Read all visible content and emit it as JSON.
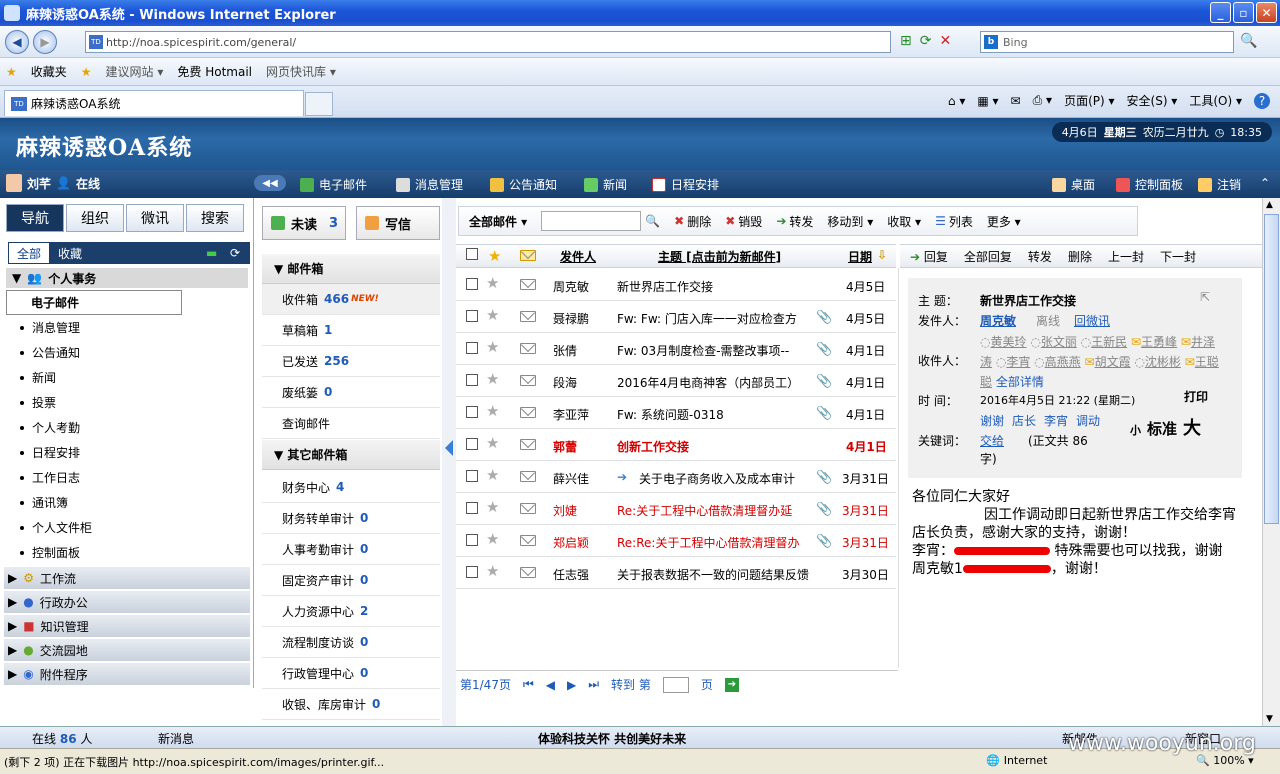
{
  "window": {
    "title": "麻辣诱惑OA系统 - Windows Internet Explorer"
  },
  "browser": {
    "url": "http://noa.spicespirit.com/general/",
    "search_placeholder": "Bing",
    "favorites_label": "收藏夹",
    "fav_items": [
      "建议网站 ▾",
      "免费 Hotmail",
      "网页快讯库 ▾"
    ],
    "tab_title": "麻辣诱惑OA系统",
    "commands": [
      "页面(P) ▾",
      "安全(S) ▾",
      "工具(O) ▾",
      "?"
    ]
  },
  "header": {
    "logo": "麻辣诱惑OA系统",
    "date": "4月6日",
    "weekday": "星期三",
    "lunar": "农历二月廿九",
    "time": "18:35"
  },
  "user": {
    "name": "刘芊",
    "status": "在线"
  },
  "menu": [
    "电子邮件",
    "消息管理",
    "公告通知",
    "新闻",
    "日程安排"
  ],
  "menu_right": [
    "桌面",
    "控制面板",
    "注销"
  ],
  "left": {
    "tabs": [
      "导航",
      "组织",
      "微讯",
      "搜索"
    ],
    "subtabs": [
      "全部",
      "收藏"
    ],
    "section": "个人事务",
    "items": [
      "电子邮件",
      "消息管理",
      "公告通知",
      "新闻",
      "投票",
      "个人考勤",
      "日程安排",
      "工作日志",
      "通讯簿",
      "个人文件柜",
      "控制面板"
    ],
    "accordion": [
      "工作流",
      "行政办公",
      "知识管理",
      "交流园地",
      "附件程序"
    ]
  },
  "folders": {
    "unread_label": "未读",
    "unread_count": "3",
    "compose_label": "写信",
    "mailbox_title": "邮件箱",
    "mailbox": [
      {
        "name": "收件箱",
        "count": "466",
        "new": "NEW!"
      },
      {
        "name": "草稿箱",
        "count": "1"
      },
      {
        "name": "已发送",
        "count": "256"
      },
      {
        "name": "废纸篓",
        "count": "0"
      },
      {
        "name": "查询邮件",
        "count": ""
      }
    ],
    "other_title": "其它邮件箱",
    "other": [
      {
        "name": "财务中心",
        "count": "4"
      },
      {
        "name": "财务转单审计",
        "count": "0"
      },
      {
        "name": "人事考勤审计",
        "count": "0"
      },
      {
        "name": "固定资产审计",
        "count": "0"
      },
      {
        "name": "人力资源中心",
        "count": "2"
      },
      {
        "name": "流程制度访谈",
        "count": "0"
      },
      {
        "name": "行政管理中心",
        "count": "0"
      },
      {
        "name": "收银、库房审计",
        "count": "0"
      }
    ]
  },
  "toolbar": {
    "all_mail": "全部邮件 ▾",
    "delete": "删除",
    "destroy": "销毁",
    "forward": "转发",
    "move": "移动到 ▾",
    "receive": "收取 ▾",
    "list": "列表",
    "more": "更多 ▾"
  },
  "columns": {
    "sender": "发件人",
    "subject": "主题 [点击前为新邮件]",
    "date": "日期"
  },
  "rows": [
    {
      "sender": "周克敏",
      "subject": "新世界店工作交接",
      "date": "4月5日",
      "clip": false,
      "style": ""
    },
    {
      "sender": "聂禄鹏",
      "subject": "Fw: Fw: 门店入库一一对应检查方",
      "date": "4月5日",
      "clip": true,
      "style": ""
    },
    {
      "sender": "张倩",
      "subject": "Fw: 03月制度检查-需整改事项--",
      "date": "4月1日",
      "clip": true,
      "style": ""
    },
    {
      "sender": "段海",
      "subject": "2016年4月电商神客（内部员工）",
      "date": "4月1日",
      "clip": true,
      "style": ""
    },
    {
      "sender": "李亚萍",
      "subject": "Fw: 系统问题-0318",
      "date": "4月1日",
      "clip": true,
      "style": ""
    },
    {
      "sender": "郭蕾",
      "subject": "创新工作交接",
      "date": "4月1日",
      "clip": false,
      "style": "red bold"
    },
    {
      "sender": "薛兴佳",
      "subject": "关于电子商务收入及成本审计",
      "date": "3月31日",
      "clip": true,
      "style": "",
      "fwd": true
    },
    {
      "sender": "刘婕",
      "subject": "Re:关于工程中心借款清理督办延",
      "date": "3月31日",
      "clip": true,
      "style": "red"
    },
    {
      "sender": "郑启颖",
      "subject": "Re:Re:关于工程中心借款清理督办",
      "date": "3月31日",
      "clip": true,
      "style": "red"
    },
    {
      "sender": "任志强",
      "subject": "关于报表数据不一致的问题结果反馈",
      "date": "3月30日",
      "clip": false,
      "style": ""
    }
  ],
  "pager": {
    "page": "第1/47页",
    "goto": "转到 第",
    "page_unit": "页"
  },
  "reader": {
    "actions": [
      "回复",
      "全部回复",
      "转发",
      "删除",
      "上一封",
      "下一封"
    ],
    "subject_label": "主 题：",
    "subject": "新世界店工作交接",
    "from_label": "发件人：",
    "from": "周克敏",
    "from_status": "离线",
    "from_reply": "回微讯",
    "to_label": "收件人：",
    "to": [
      "黄美玲",
      "张文丽",
      "王新民",
      "王勇峰",
      "井泽涛",
      "李宵",
      "高燕燕",
      "胡文霞",
      "沈彬彬",
      "王聪聪"
    ],
    "to_more": "全部详情",
    "time_label": "时 间：",
    "time": "2016年4月5日 21:22 (星期二)",
    "print": "打印",
    "links": [
      "谢谢",
      "店长",
      "李宵",
      "调动"
    ],
    "size_small": "小",
    "size_std": "标准",
    "size_big": "大",
    "keyword_label": "关键词：",
    "keyword": "交给",
    "word_count": "(正文共 86 字)",
    "body": [
      "各位同仁大家好",
      "因工作调动即日起新世界店工作交给李宵店长负责，感谢大家的支持，谢谢！",
      "李宵：",
      "特殊需要也可以找我，谢谢",
      "周克敏1",
      "，谢谢！"
    ]
  },
  "footer": {
    "online_label": "在线",
    "online_count": "86",
    "online_unit": "人",
    "new_msg": "新消息",
    "slogan": "体验科技关怀 共创美好未来",
    "new_mail": "新邮件",
    "new_window": "新窗口"
  },
  "status": {
    "text": "(剩下 2 项) 正在下载图片 http://noa.spicespirit.com/images/printer.gif...",
    "zone": "Internet",
    "zoom": "100%",
    "watermark": "www.wooyun.org"
  }
}
